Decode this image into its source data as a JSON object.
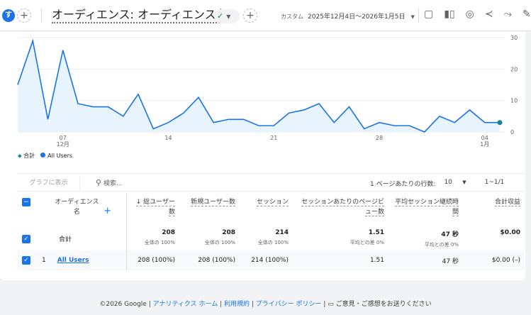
{
  "header": {
    "avatar": "す",
    "title": "オーディエンス: オーディエンス名",
    "check": "⊘",
    "date_label": "カスタム",
    "date_range": "2025年12月4日～2026年1月5日"
  },
  "chart_data": {
    "type": "area",
    "title": "",
    "xlabel": "",
    "ylabel": "",
    "x_ticks": [
      {
        "label": "07",
        "sub": "12月",
        "index": 3
      },
      {
        "label": "14",
        "index": 10
      },
      {
        "label": "21",
        "index": 17
      },
      {
        "label": "28",
        "index": 24
      },
      {
        "label": "04",
        "sub": "1月",
        "index": 31
      }
    ],
    "y_ticks": [
      0,
      10,
      20,
      30
    ],
    "ylim": [
      0,
      30
    ],
    "series": [
      {
        "name": "All Users",
        "color": "#1a73e8",
        "values": [
          15,
          29,
          4,
          26,
          9,
          8,
          8,
          5,
          12,
          1,
          3,
          6,
          11,
          3,
          4,
          4,
          2,
          2,
          6,
          7,
          9,
          3,
          8,
          1,
          3,
          2,
          2,
          0,
          5,
          3,
          7,
          3,
          3
        ]
      }
    ],
    "legend": [
      "合計",
      "All Users"
    ]
  },
  "toolbar": {
    "show_chart": "グラフに表示",
    "search_placeholder": "検索...",
    "rows_label": "1 ページあたりの行数:",
    "rows_value": "10",
    "pagination": "1~1/1"
  },
  "table": {
    "headers": [
      "オーディエンス名",
      "↓ 総ユーザー数",
      "新規ユーザー数",
      "セッション",
      "セッションあたりのページビュー数",
      "平均セッション継続時間",
      "合計収益"
    ],
    "total": {
      "label": "合計",
      "values": [
        "208",
        "208",
        "214",
        "1.51",
        "47 秒",
        "$0.00"
      ],
      "subs": [
        "全体の 100%",
        "全体の 100%",
        "全体の 100%",
        "平均との差 0%",
        "平均との差 0%",
        ""
      ]
    },
    "rows": [
      {
        "index": "1",
        "name": "All Users",
        "values": [
          "208 (100%)",
          "208 (100%)",
          "214 (100%)",
          "1.51",
          "47 秒",
          "$0.00 (–)"
        ]
      }
    ]
  },
  "footer": {
    "copyright": "©2026 Google",
    "links": [
      "アナリティクス ホーム",
      "利用規約",
      "プライバシー ポリシー"
    ],
    "feedback": "ご意見・ご感想をお送りください"
  }
}
